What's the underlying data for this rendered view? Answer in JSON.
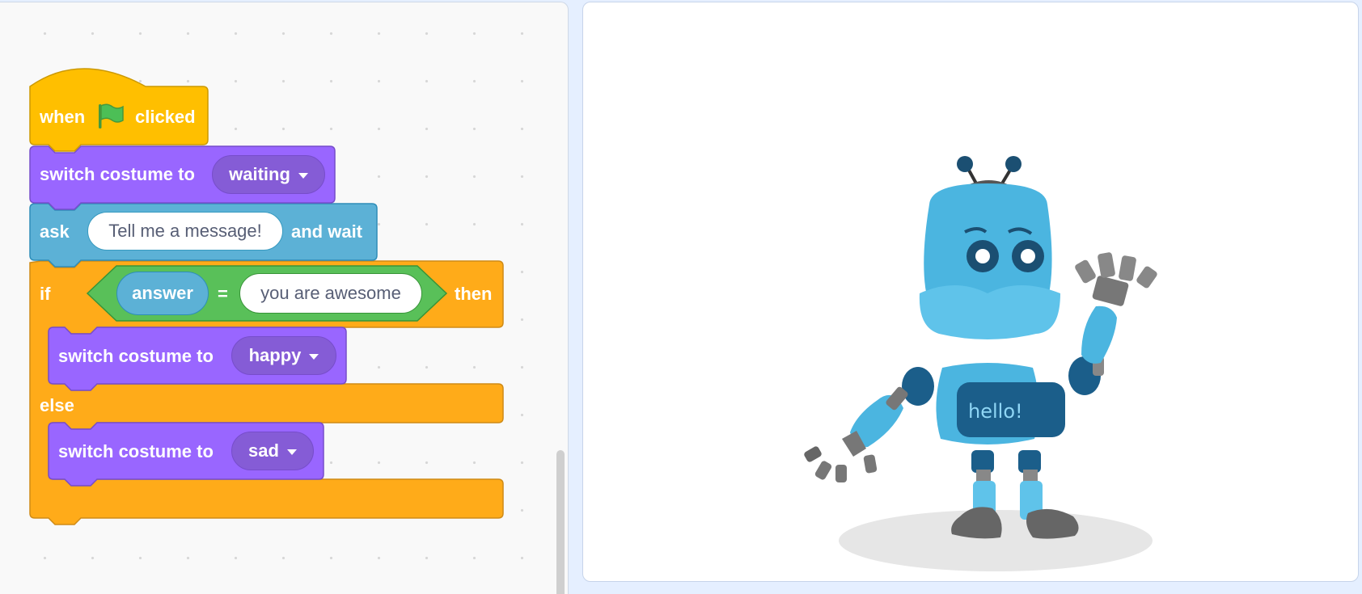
{
  "code_area": {
    "script": {
      "hat": {
        "prefix": "when",
        "flag_icon": "green-flag-icon",
        "suffix": "clicked"
      },
      "switch_1": {
        "label": "switch costume to",
        "costume": "waiting"
      },
      "ask": {
        "label": "ask",
        "message": "Tell me a message!",
        "suffix": "and wait"
      },
      "if_else": {
        "if_label": "if",
        "condition": {
          "left": "answer",
          "operator": "=",
          "right": "you are awesome"
        },
        "then_label": "then",
        "else_label": "else",
        "if_branch": {
          "label": "switch costume to",
          "costume": "happy"
        },
        "else_branch": {
          "label": "switch costume to",
          "costume": "sad"
        }
      }
    },
    "colors": {
      "events": "#ffbf00",
      "looks": "#9966ff",
      "sensing": "#5cb1d6",
      "control": "#ffab19",
      "operators": "#59c059"
    }
  },
  "stage": {
    "sprite": {
      "name": "robot",
      "screen_text": "hello!"
    }
  }
}
